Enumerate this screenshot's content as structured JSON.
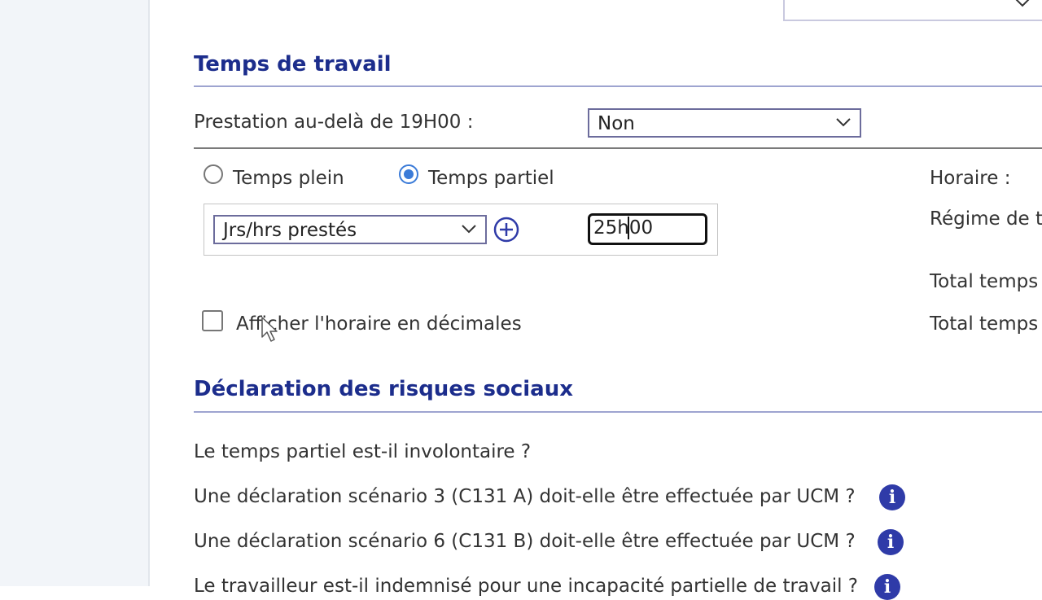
{
  "top": {
    "select_value": ""
  },
  "work_time": {
    "title": "Temps de travail",
    "prestation_label": "Prestation au-delà de 19H00 :",
    "prestation_value": "Non",
    "radio_full": "Temps plein",
    "radio_partial": "Temps partiel",
    "radio_selected": "Temps partiel",
    "mode_select_value": "Jrs/hrs prestés",
    "hours_value": "25h00",
    "decimal_checkbox_label": "Afficher l'horaire en décimales",
    "decimal_checked": false
  },
  "right_column": {
    "horaire": "Horaire :",
    "regime": "Régime de t",
    "total1": "Total temps",
    "total2": "Total temps"
  },
  "social_risks": {
    "title": "Déclaration des risques sociaux",
    "q1": "Le temps partiel est-il involontaire ?",
    "q2": "Une déclaration scénario 3 (C131 A) doit-elle être effectuée par UCM ?",
    "q3": "Une déclaration scénario 6 (C131 B) doit-elle être effectuée par UCM ?",
    "q4": "Le travailleur est-il indemnisé pour une incapacité partielle de travail ?",
    "info_icon": "i"
  },
  "colors": {
    "title": "#1c2d8c",
    "info": "#2f3ba8",
    "radio": "#3b7bd8"
  }
}
